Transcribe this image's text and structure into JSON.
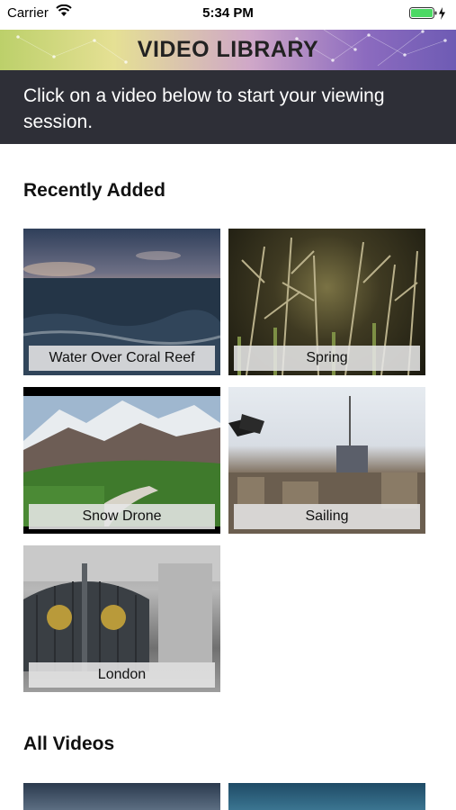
{
  "status_bar": {
    "carrier": "Carrier",
    "time": "5:34 PM"
  },
  "header": {
    "title": "VIDEO LIBRARY"
  },
  "instructions": "Click on a video below to start your viewing session.",
  "sections": {
    "recently_added": "Recently Added",
    "all_videos": "All Videos"
  },
  "recent_videos": [
    {
      "title": "Water Over Coral Reef"
    },
    {
      "title": "Spring"
    },
    {
      "title": "Snow Drone"
    },
    {
      "title": "Sailing"
    },
    {
      "title": "London"
    }
  ],
  "colors": {
    "instruction_bg": "#2e2f37",
    "battery": "#4cd964"
  }
}
